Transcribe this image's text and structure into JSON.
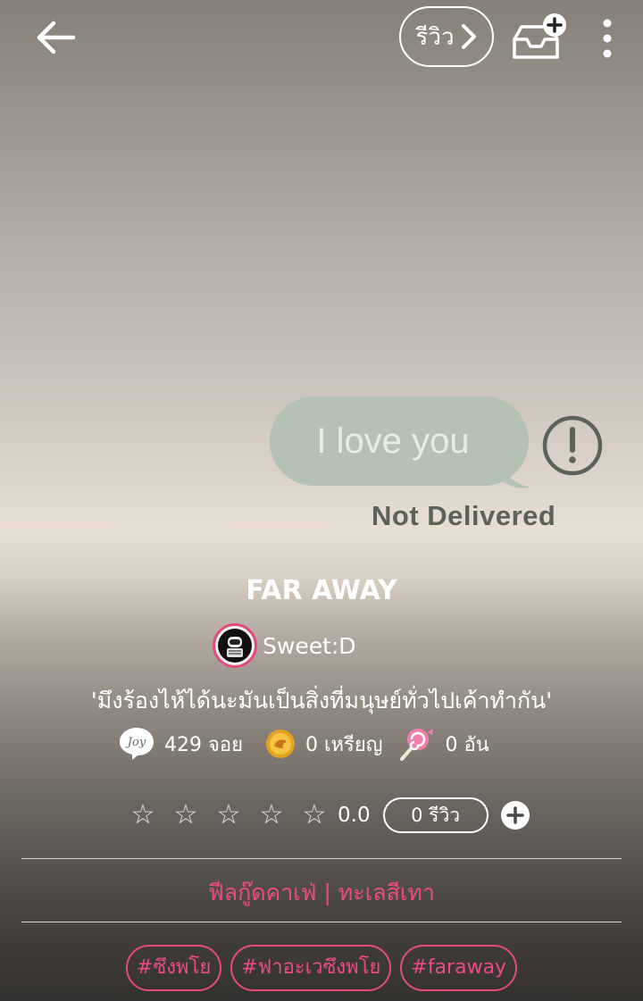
{
  "header": {
    "review_label": "รีวิว"
  },
  "cover": {
    "bubble_text": "I love you",
    "status_text": "Not Delivered"
  },
  "story": {
    "title": "FAR AWAY",
    "author": "Sweet:D",
    "tagline": "'มึงร้องไห้ได้นะมันเป็นสิ่งที่มนุษย์ทั่วไปเค้าทำกัน'",
    "joy_badge": "Joy",
    "stats": {
      "joy": "429 จอย",
      "coins": "0 เหรียญ",
      "candies": "0 อัน"
    },
    "rating": {
      "stars_filled": 0,
      "stars_total": 5,
      "score": "0.0",
      "review_count": "0 รีวิว"
    },
    "category": "ฟีลกู๊ดคาเฟ่  | ทะเลสีเทา",
    "tags": [
      "#ซึงพโย",
      "#ฟาอะเวซึงพโย",
      "#faraway"
    ]
  },
  "colors": {
    "accent": "#e64a7b",
    "bubble": "#b4c2b2"
  },
  "icons": [
    "back-arrow-icon",
    "chevron-right-icon",
    "inbox-add-icon",
    "more-vertical-icon",
    "alert-icon",
    "joy-icon",
    "coin-icon",
    "candy-icon",
    "star-outline-icon",
    "plus-circle-icon"
  ]
}
